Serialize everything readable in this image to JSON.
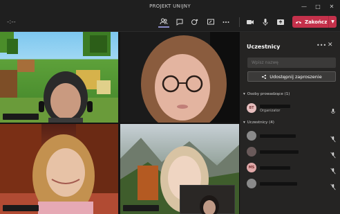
{
  "window": {
    "title": "PROJEKT UNIJNY",
    "controls": [
      "minimize",
      "maximize",
      "close"
    ]
  },
  "toolbar": {
    "timer": "-:--",
    "icons": [
      "people-icon",
      "chat-icon",
      "reactions-icon",
      "share-tray-icon",
      "more-icon",
      "camera-icon",
      "mic-icon",
      "share-screen-icon"
    ],
    "leave_label": "Zakończ"
  },
  "panel": {
    "title": "Uczestnicy",
    "search_placeholder": "Wpisz nazwę",
    "share_invite_label": "Udostępnij zaproszenie",
    "organizers_section": "Osoby prowadzące (1)",
    "attendees_section": "Uczestnicy (4)",
    "organizer": {
      "initials": "BT",
      "role": "Organizator"
    },
    "attendees": [
      {
        "initials": "",
        "avatar_color": "#8a8a8a"
      },
      {
        "initials": "",
        "avatar_color": "#6a5a5a"
      },
      {
        "initials": "MS",
        "avatar_color": "#d9a3a3"
      },
      {
        "initials": "",
        "avatar_color": "#8a8a8a"
      }
    ]
  }
}
